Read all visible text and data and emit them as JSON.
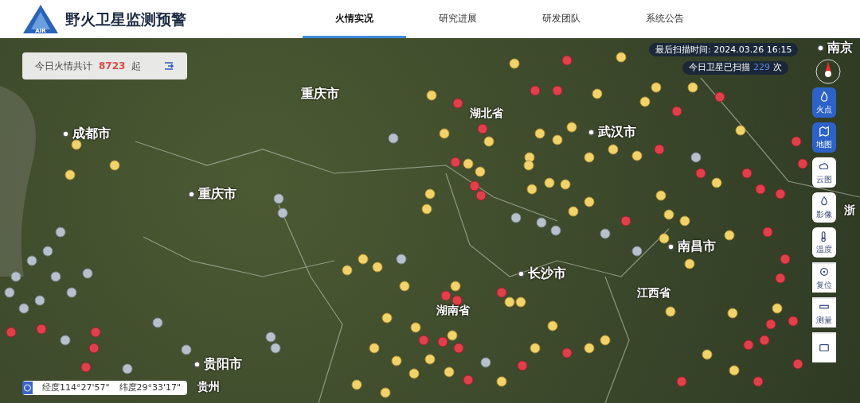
{
  "header": {
    "logo_text": "AIR",
    "title": "野火卫星监测预警",
    "nav": [
      {
        "label": "火情实况",
        "selected": true
      },
      {
        "label": "研究进展",
        "selected": false
      },
      {
        "label": "研发团队",
        "selected": false
      },
      {
        "label": "系统公告",
        "selected": false
      }
    ]
  },
  "fire_count": {
    "label": "今日火情共计",
    "value": "8723",
    "unit": "起"
  },
  "scan_info": {
    "last_scan": "最后扫描时间: 2024.03.26 16:15",
    "today_label": "今日卫星已扫描",
    "today_count": "229",
    "today_unit": "次"
  },
  "map_labels": [
    {
      "text": "重庆市",
      "kind": "district"
    },
    {
      "text": "成都市",
      "kind": "city"
    },
    {
      "text": "湖北省",
      "kind": "province"
    },
    {
      "text": "武汉市",
      "kind": "city"
    },
    {
      "text": "重庆市",
      "kind": "city"
    },
    {
      "text": "南昌市",
      "kind": "city"
    },
    {
      "text": "长沙市",
      "kind": "city"
    },
    {
      "text": "江西省",
      "kind": "province"
    },
    {
      "text": "湖南省",
      "kind": "province"
    },
    {
      "text": "贵阳市",
      "kind": "city"
    },
    {
      "text": "贵州",
      "kind": "province"
    },
    {
      "text": "南京",
      "kind": "city"
    },
    {
      "text": "浙",
      "kind": "province"
    }
  ],
  "toolbar": [
    {
      "label": "火点",
      "kind": "layer",
      "selected": true
    },
    {
      "label": "地图",
      "kind": "layer",
      "selected": true
    },
    {
      "label": "云图",
      "kind": "layer",
      "selected": false
    },
    {
      "label": "影像",
      "kind": "layer",
      "selected": false
    },
    {
      "label": "温度",
      "kind": "layer",
      "selected": false
    },
    {
      "label": "复位",
      "kind": "tool",
      "selected": false
    },
    {
      "label": "测量",
      "kind": "tool",
      "selected": false
    },
    {
      "kind": "tool",
      "selected": false
    }
  ],
  "coordinates": {
    "longitude": "经度114°27'57\"",
    "latitude": "纬度29°33'17\""
  }
}
